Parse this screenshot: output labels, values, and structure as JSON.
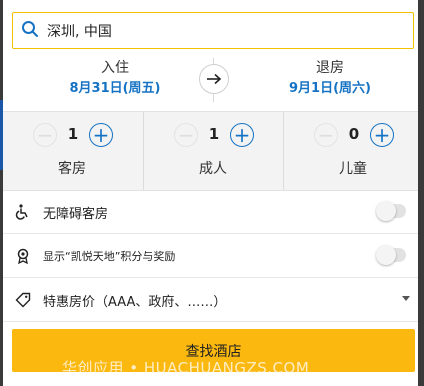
{
  "search": {
    "value": "深圳, 中国"
  },
  "checkin": {
    "label": "入住",
    "date": "8月31日(周五)"
  },
  "checkout": {
    "label": "退房",
    "date": "9月1日(周六)"
  },
  "counters": [
    {
      "count": "1",
      "label": "客房"
    },
    {
      "count": "1",
      "label": "成人"
    },
    {
      "count": "0",
      "label": "儿童"
    }
  ],
  "options": {
    "accessible": {
      "label": "无障碍客房",
      "on": false
    },
    "points": {
      "label": "显示“凯悦天地”积分与奖励",
      "on": false
    },
    "special_rates": {
      "label": "特惠房价（AAA、政府、……）"
    }
  },
  "find_button": "查找酒店",
  "watermark": "华创应用 • HUACHUANGZS.COM",
  "colors": {
    "accent": "#1673c4",
    "button": "#fbb80f",
    "search_border": "#f3c200"
  }
}
